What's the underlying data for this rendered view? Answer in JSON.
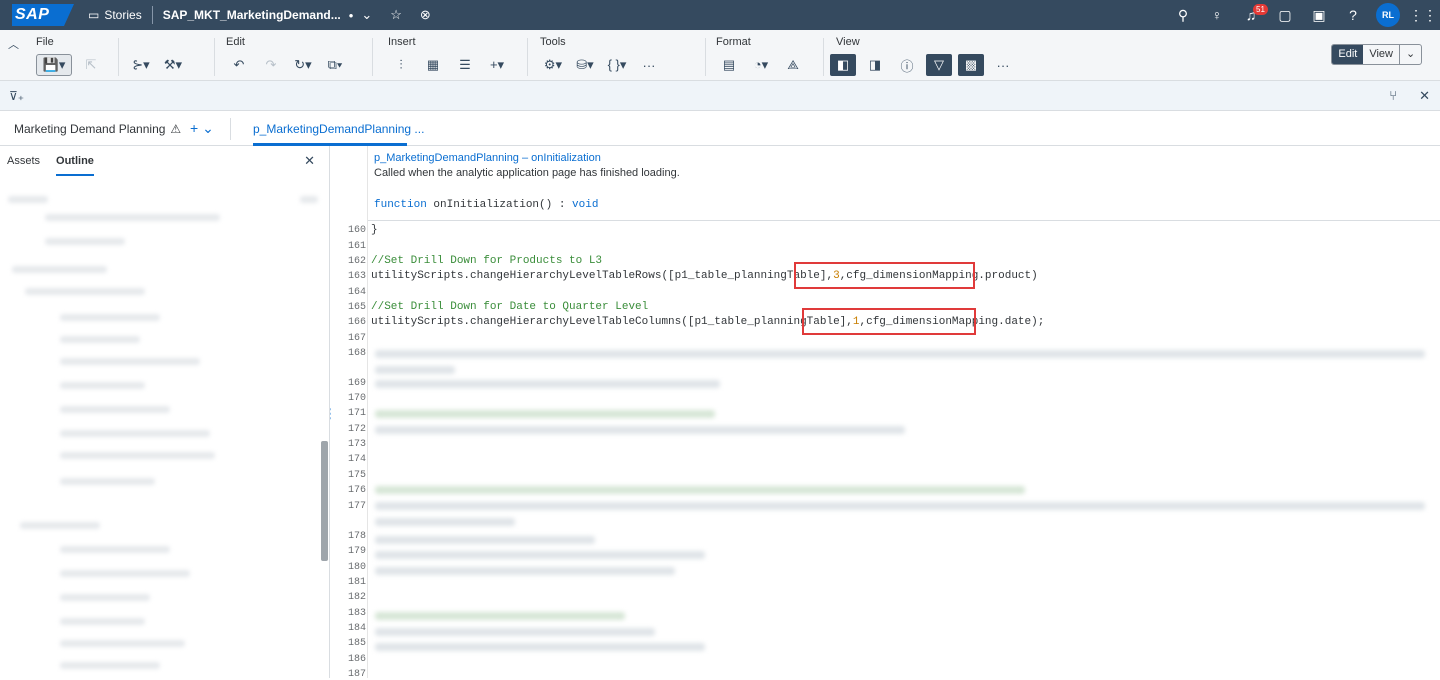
{
  "shell": {
    "logo": "SAP",
    "stories": "Stories",
    "title": "SAP_MKT_MarketingDemand...",
    "dot": "•",
    "notifications_count": "51",
    "avatar_initials": "RL"
  },
  "toolbar": {
    "file": "File",
    "edit": "Edit",
    "insert": "Insert",
    "tools": "Tools",
    "format": "Format",
    "view": "View",
    "mode_edit": "Edit",
    "mode_view": "View"
  },
  "tabs": {
    "story_tab": "Marketing Demand Planning",
    "script_tab": "p_MarketingDemandPlanning ..."
  },
  "left_panel": {
    "tab_assets": "Assets",
    "tab_outline": "Outline"
  },
  "editor": {
    "doc_title": "p_MarketingDemandPlanning – onInitialization",
    "doc_desc": "Called when the analytic application page has finished loading.",
    "sig_kw": "function",
    "sig_name": " onInitialization() : ",
    "sig_ret": "void",
    "lines": [
      {
        "n": "160",
        "code": "}"
      },
      {
        "n": "161",
        "code": ""
      },
      {
        "n": "162",
        "comment": "//Set Drill Down for Products to L3"
      },
      {
        "n": "163",
        "pre": "utilityScripts.changeHierarchyLevelTableRows([p1_table_planningTable],",
        "num": "3",
        "post": ",cfg_dimensionMapping.product)"
      },
      {
        "n": "164",
        "code": ""
      },
      {
        "n": "165",
        "comment": "//Set Drill Down for Date to Quarter Level"
      },
      {
        "n": "166",
        "pre": "utilityScripts.changeHierarchyLevelTableColumns([p1_table_planningTable],",
        "num": "1",
        "post": ",cfg_dimensionMapping.date);"
      },
      {
        "n": "167"
      },
      {
        "n": "168"
      },
      {
        "n": "169"
      },
      {
        "n": "170"
      },
      {
        "n": "171"
      },
      {
        "n": "172"
      },
      {
        "n": "173"
      },
      {
        "n": "174"
      },
      {
        "n": "175"
      },
      {
        "n": "176"
      },
      {
        "n": "177"
      },
      {
        "n": "178"
      },
      {
        "n": "179"
      },
      {
        "n": "180"
      },
      {
        "n": "181"
      },
      {
        "n": "182"
      },
      {
        "n": "183"
      },
      {
        "n": "184"
      },
      {
        "n": "185"
      },
      {
        "n": "186"
      },
      {
        "n": "187"
      }
    ]
  },
  "colors": {
    "shell_bg": "#354a5f",
    "accent": "#0a6ed1",
    "highlight_box": "#e03a3a",
    "comment": "#3a8d3a"
  }
}
